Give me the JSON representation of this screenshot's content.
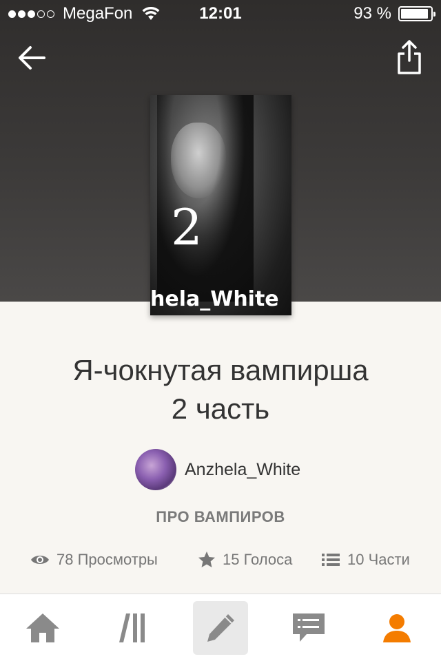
{
  "status_bar": {
    "carrier": "MegaFon",
    "time": "12:01",
    "battery": "93 %",
    "battery_level": 0.93
  },
  "story": {
    "cover_number": "2",
    "cover_author": "hela_White",
    "title_line1": "Я-чокнутая вампирша",
    "title_line2": "2 часть",
    "author": "Anzhela_White",
    "category": "ПРО ВАМПИРОВ"
  },
  "stats": {
    "views": "78 Просмотры",
    "votes": "15 Голоса",
    "parts": "10 Части"
  },
  "tabbar": {
    "items": [
      "home-icon",
      "library-icon",
      "write-icon",
      "messages-icon",
      "profile-icon"
    ],
    "active_color": "#f47c00",
    "inactive_color": "#8a8a8a"
  }
}
